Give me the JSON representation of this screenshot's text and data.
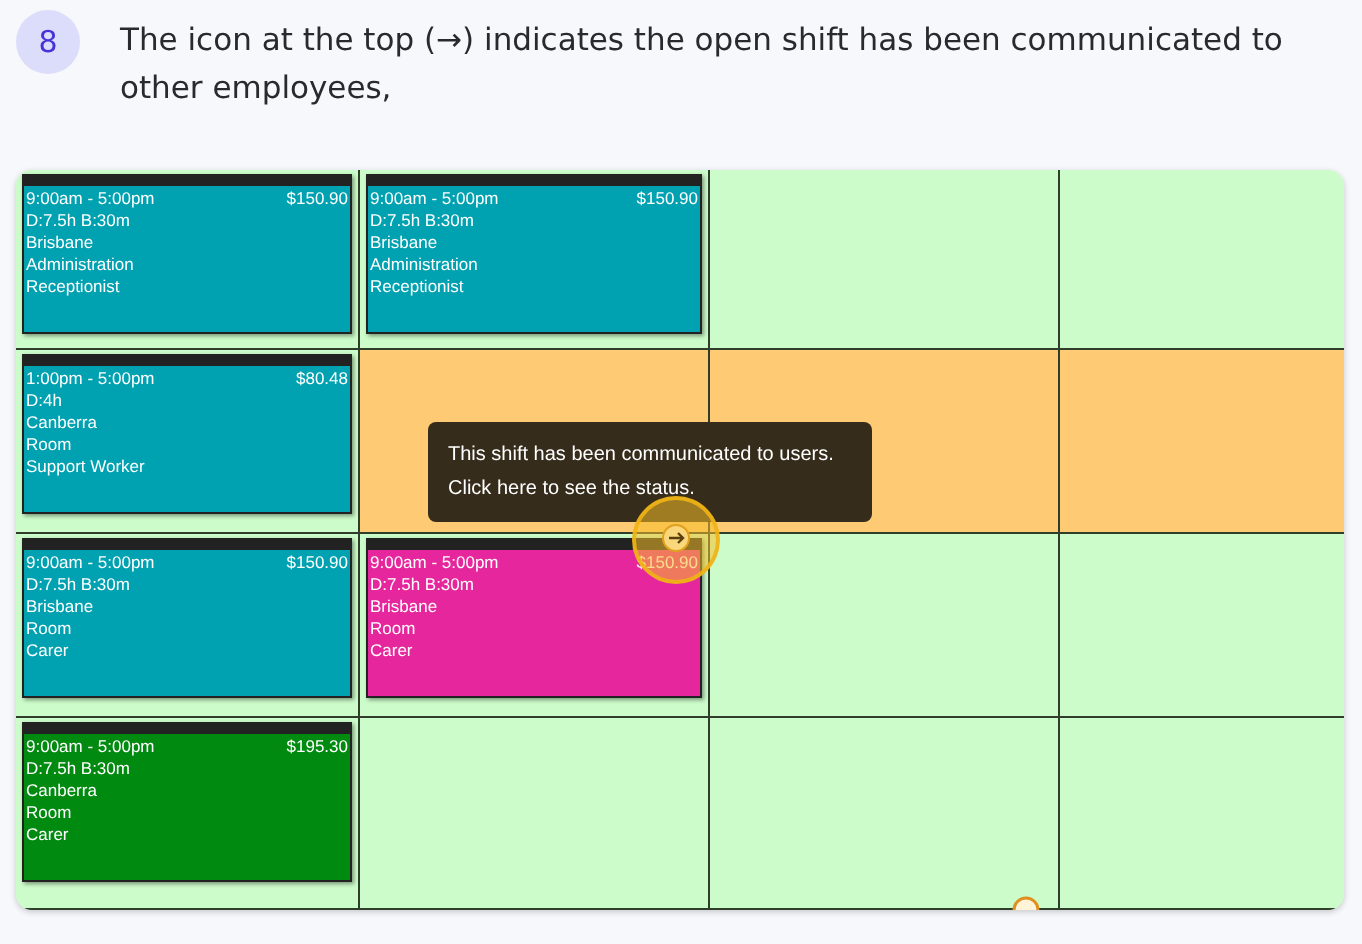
{
  "step": {
    "number": "8",
    "text": "The icon at the top (→) indicates the open shift has been communicated to other employees,"
  },
  "roster": {
    "rows": [
      {
        "cells": [
          {
            "highlighted": false,
            "shift": {
              "time": "9:00am - 5:00pm",
              "price": "$150.90",
              "lines": [
                "D:7.5h B:30m",
                "Brisbane",
                "Administration",
                "Receptionist"
              ],
              "color": "#00a1b0"
            }
          },
          {
            "highlighted": false,
            "shift": {
              "time": "9:00am - 5:00pm",
              "price": "$150.90",
              "lines": [
                "D:7.5h B:30m",
                "Brisbane",
                "Administration",
                "Receptionist"
              ],
              "color": "#00a1b0"
            }
          },
          {
            "highlighted": false
          },
          {
            "highlighted": false
          }
        ]
      },
      {
        "cells": [
          {
            "highlighted": false,
            "shift": {
              "time": "1:00pm - 5:00pm",
              "price": "$80.48",
              "lines": [
                "D:4h",
                "Canberra",
                "Room",
                "Support Worker"
              ],
              "color": "#00a1b0"
            }
          },
          {
            "highlighted": true
          },
          {
            "highlighted": true
          },
          {
            "highlighted": true
          }
        ]
      },
      {
        "cells": [
          {
            "highlighted": false,
            "shift": {
              "time": "9:00am - 5:00pm",
              "price": "$150.90",
              "lines": [
                "D:7.5h B:30m",
                "Brisbane",
                "Room",
                "Carer"
              ],
              "color": "#00a1b0"
            }
          },
          {
            "highlighted": false,
            "shift": {
              "time": "9:00am - 5:00pm",
              "price": "$150.90",
              "lines": [
                "D:7.5h B:30m",
                "Brisbane",
                "Room",
                "Carer"
              ],
              "color": "#e6269c"
            }
          },
          {
            "highlighted": false
          },
          {
            "highlighted": false
          }
        ]
      },
      {
        "cells": [
          {
            "highlighted": false,
            "shift": {
              "time": "9:00am - 5:00pm",
              "price": "$195.30",
              "lines": [
                "D:7.5h B:30m",
                "Canberra",
                "Room",
                "Carer"
              ],
              "color": "#008a10"
            }
          },
          {
            "highlighted": false
          },
          {
            "highlighted": false
          },
          {
            "highlighted": false
          }
        ]
      }
    ],
    "tooltip": "This shift has been communicated to users. Click here to see the status."
  }
}
